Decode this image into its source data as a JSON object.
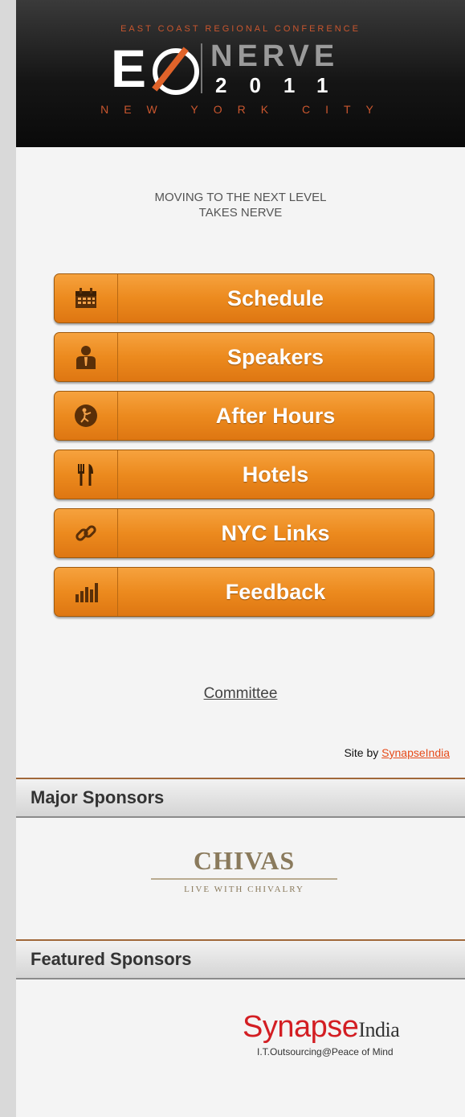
{
  "header": {
    "top_line": "EAST COAST REGIONAL CONFERENCE",
    "logo_eo": "EO",
    "logo_nerve": "NERVE",
    "logo_year": "2011",
    "logo_city": "NEW YORK CITY"
  },
  "tagline": {
    "line1": "MOVING TO THE NEXT LEVEL",
    "line2": "TAKES NERVE"
  },
  "nav": [
    {
      "label": "Schedule",
      "icon": "calendar-icon"
    },
    {
      "label": "Speakers",
      "icon": "person-icon"
    },
    {
      "label": "After Hours",
      "icon": "dancer-icon"
    },
    {
      "label": "Hotels",
      "icon": "fork-knife-icon"
    },
    {
      "label": "NYC Links",
      "icon": "link-icon"
    },
    {
      "label": "Feedback",
      "icon": "bar-chart-icon"
    }
  ],
  "committee_link": "Committee",
  "site_by": {
    "prefix": "Site by",
    "link": "SynapseIndia"
  },
  "sponsors": {
    "major_title": "Major Sponsors",
    "featured_title": "Featured Sponsors",
    "chivas_name": "CHIVAS",
    "chivas_tagline": "LIVE WITH CHIVALRY",
    "synapse_name": "Synapse",
    "synapse_suffix": "India",
    "synapse_tagline": "I.T.Outsourcing@Peace of Mind"
  },
  "colors": {
    "button_orange": "#ec8a1e",
    "header_dark": "#151515",
    "accent_orange": "#c9562e",
    "link_red": "#e64a19"
  }
}
